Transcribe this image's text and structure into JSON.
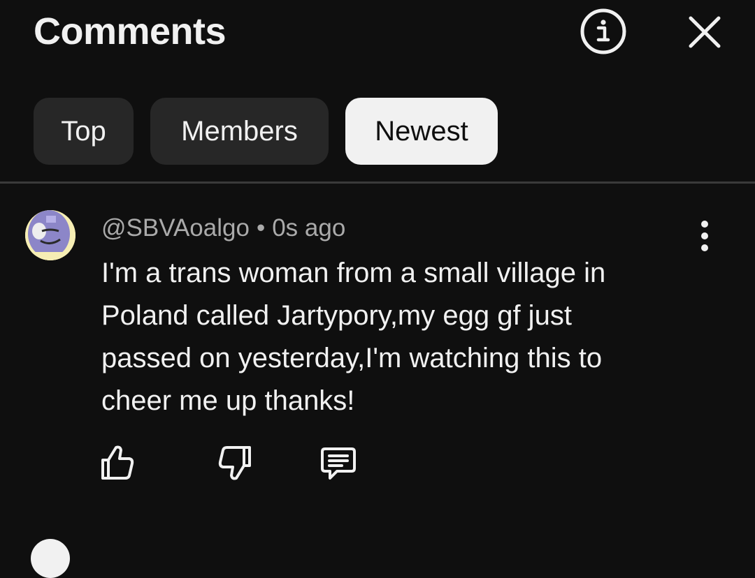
{
  "header": {
    "title": "Comments",
    "info_icon": "info-icon",
    "close_icon": "close-icon"
  },
  "filters": {
    "chips": [
      {
        "label": "Top",
        "active": false
      },
      {
        "label": "Members",
        "active": false
      },
      {
        "label": "Newest",
        "active": true
      }
    ]
  },
  "comment": {
    "author": "@SBVAoalgo",
    "separator": "•",
    "time": "0s ago",
    "text": "I'm a trans woman from a small village in\nPoland called Jartypory,my egg gf just\npassed on  yesterday,I'm watching this to\ncheer me up thanks!",
    "avatar_icon": "avatar",
    "more_icon": "more-vert-icon",
    "actions": {
      "like_icon": "thumbs-up-icon",
      "dislike_icon": "thumbs-down-icon",
      "reply_icon": "reply-comment-icon"
    }
  },
  "colors": {
    "background": "#0f0f0f",
    "chip_bg": "#272727",
    "chip_active_bg": "#f1f1f1",
    "text_primary": "#f1f1f1",
    "text_secondary": "#aaaaaa"
  }
}
